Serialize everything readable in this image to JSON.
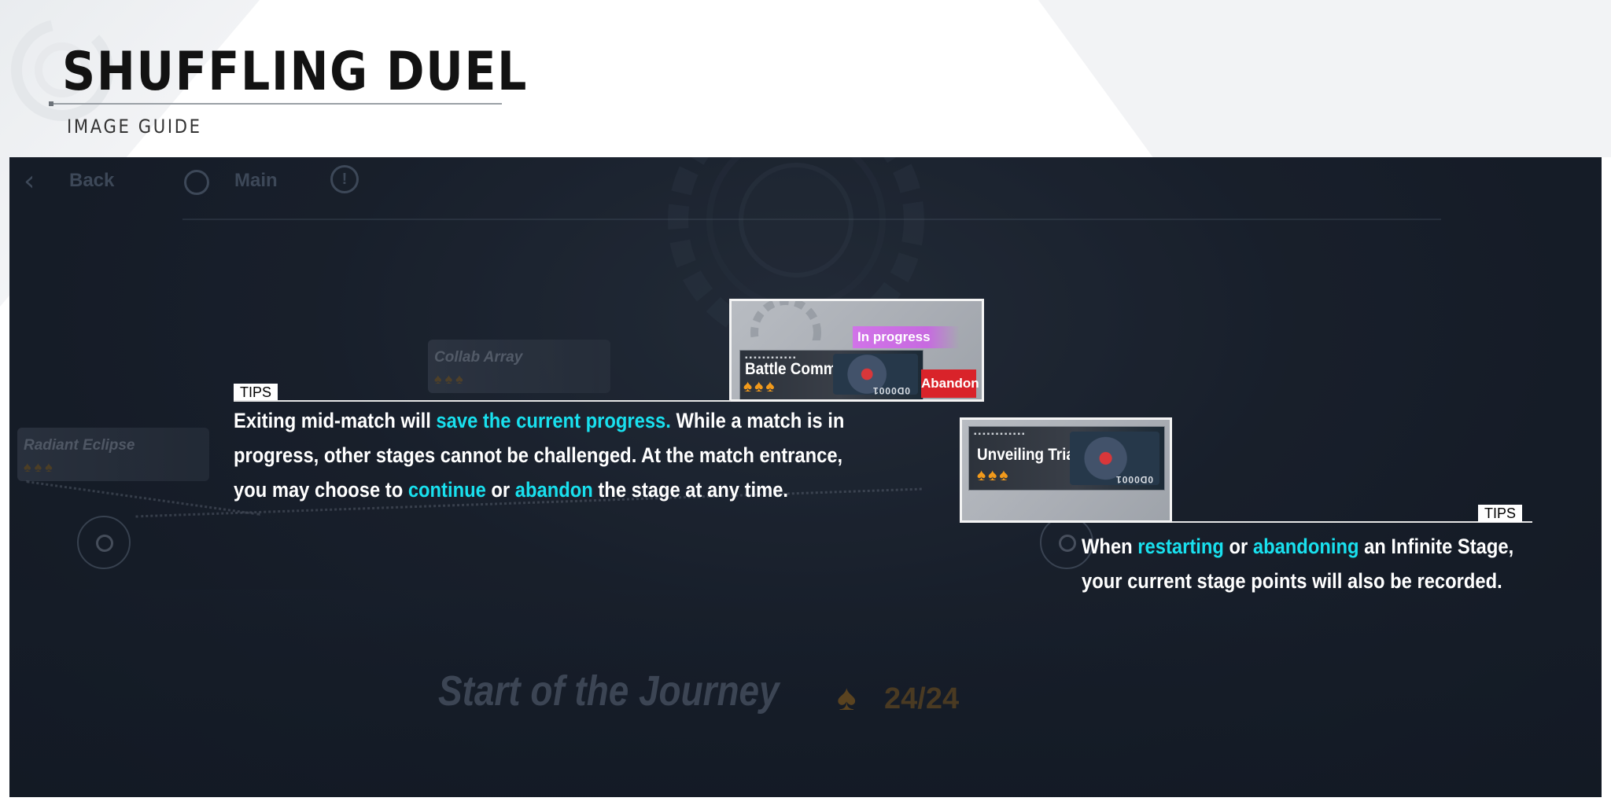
{
  "header": {
    "title": "SHUFFLING DUEL",
    "subtitle": "IMAGE GUIDE"
  },
  "nav": {
    "back_label": "Back",
    "main_label": "Main",
    "info_glyph": "!"
  },
  "background": {
    "stages": [
      {
        "name": "Collab Array",
        "stars": "♠♠♠"
      },
      {
        "name": "Radiant Eclipse",
        "stars": "♠♠♠"
      }
    ],
    "journey": {
      "title": "Start of the Journey",
      "spade": "♠",
      "count": "24/24"
    }
  },
  "cards": {
    "battle_command": {
      "name": "Battle Command",
      "stars": "♠♠♠",
      "status": "In progress",
      "abandon_label": "Abandon",
      "code": "0D0001",
      "dots": "▪▪▪▪▪▪▪▪▪▪▪▪"
    },
    "unveiling_trial": {
      "name": "Unveiling Trial",
      "stars": "♠♠♠",
      "code": "0D0001",
      "dots": "▪▪▪▪▪▪▪▪▪▪▪▪"
    }
  },
  "tips": [
    {
      "badge": "TIPS",
      "segments": [
        {
          "text": "Exiting mid-match will ",
          "highlight": false
        },
        {
          "text": "save the current progress.",
          "highlight": true
        },
        {
          "text": " While a match is in",
          "highlight": false
        },
        {
          "text": "progress, other stages cannot be challenged. At the match entrance,",
          "highlight": false
        },
        {
          "text": "you may choose to ",
          "highlight": false
        },
        {
          "text": "continue",
          "highlight": true
        },
        {
          "text": " or ",
          "highlight": false
        },
        {
          "text": "abandon",
          "highlight": true
        },
        {
          "text": " the stage at any time.",
          "highlight": false
        }
      ]
    },
    {
      "badge": "TIPS",
      "segments": [
        {
          "text": "When ",
          "highlight": false
        },
        {
          "text": "restarting",
          "highlight": true
        },
        {
          "text": " or ",
          "highlight": false
        },
        {
          "text": "abandoning",
          "highlight": true
        },
        {
          "text": " an Infinite Stage,",
          "highlight": false
        },
        {
          "text": "your current stage points will also be recorded.",
          "highlight": false
        }
      ]
    }
  ],
  "colors": {
    "highlight": "#19e0ee",
    "status_badge": "#d173e8",
    "abandon": "#d9232a",
    "spade": "#f29a1b"
  }
}
